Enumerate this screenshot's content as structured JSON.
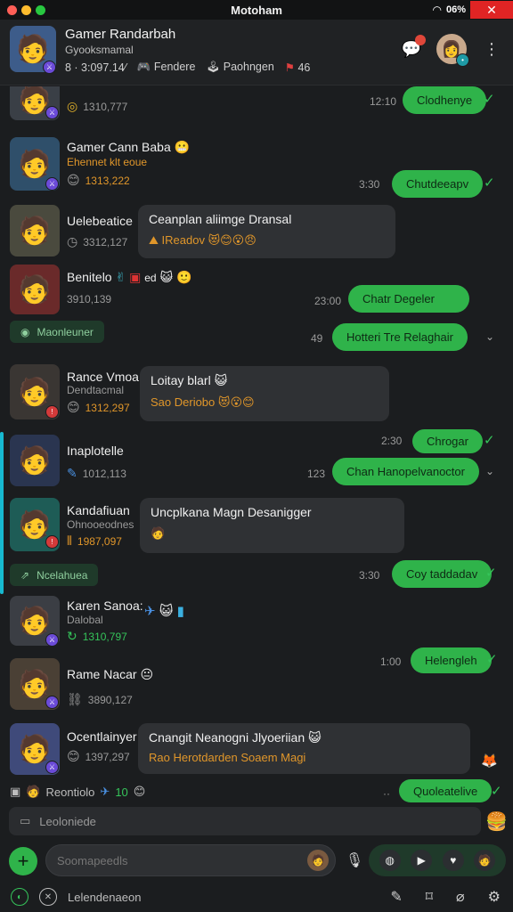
{
  "window": {
    "title": "Motoham",
    "battery": "06%"
  },
  "header": {
    "name": "Gamer Randarbah",
    "subtitle": "Gyooksmamal",
    "stats": [
      {
        "icon": "person-icon",
        "text": "8 · 3:097.14⁄"
      },
      {
        "icon": "controller-icon",
        "text": "Fendere"
      },
      {
        "icon": "gamepad-icon",
        "text": "Paohngen"
      },
      {
        "icon": "flag-icon",
        "text": "46"
      }
    ]
  },
  "chats": [
    {
      "name": "",
      "meta": "1310,777",
      "time": "12:10",
      "out": "Clodhenye"
    },
    {
      "name": "Gamer Cann Baba",
      "sub": "Ehennet klt eoue",
      "meta": "1313,222",
      "time": "3:30",
      "out": "Chutdeeapv"
    },
    {
      "name": "Uelebeatice",
      "meta": "3312,127",
      "in_title": "Ceanplan aliimge Dransal",
      "in_sub": "IReadov"
    },
    {
      "name": "Benitelo",
      "meta": "3910,139",
      "time": "23:00",
      "out": "Chatr Degeler",
      "pill": "Maonleuner",
      "time2": "49",
      "out2": "Hotteri Tre Relaghair"
    },
    {
      "name": "Rance Vmoa:",
      "sub": "Dendtacmal",
      "meta": "1312,297",
      "in_title": "Loitay blarl",
      "in_sub": "Sao Deriobo"
    },
    {
      "name": "Inaplotelle",
      "meta": "1012,113",
      "time": "2:30",
      "out": "Chrogar",
      "time2": "123",
      "out2": "Chan Hanopelvanoctor"
    },
    {
      "name": "Kandafiuan",
      "sub": "Ohnooeodnes",
      "meta": "1987,097",
      "in_title": "Uncplkana Magn Desanigger",
      "pill": "Ncelahuea",
      "time": "3:30",
      "out": "Coy taddadav"
    },
    {
      "name": "Karen Sanoa:",
      "sub": "Dalobal",
      "meta": "1310,797"
    },
    {
      "name": "Rame Nacar",
      "meta": "3890,127",
      "time": "1:00",
      "out": "Helengleh"
    },
    {
      "name": "Ocentlainyer",
      "meta": "1397,297",
      "in_title": "Cnangit Neanogni Jlyoeriian",
      "in_sub": "Rao Herotdarden Soaem Magi"
    },
    {
      "name": "Reontiolo",
      "meta": "10",
      "out": "Quoleatelive"
    }
  ],
  "composer": {
    "reply_placeholder": "Leoloniede",
    "input_placeholder": "Soomapeedls",
    "bottom_label": "Lelendenaeon"
  }
}
